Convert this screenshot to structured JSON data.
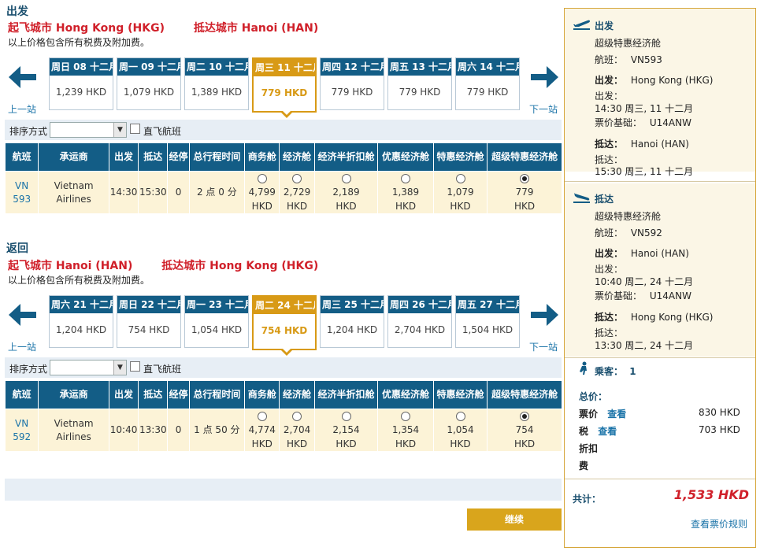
{
  "outbound": {
    "section_title": "出发",
    "from_label": "起飞城市 Hong Kong (HKG)",
    "to_label": "抵达城市 Hanoi (HAN)",
    "tax_note": "以上价格包含所有税费及附加费。",
    "prev_label": "上一站",
    "next_label": "下一站",
    "dates": [
      {
        "label": "周日 08 十二月",
        "price": "1,239 HKD",
        "selected": false
      },
      {
        "label": "周一 09 十二月",
        "price": "1,079 HKD",
        "selected": false
      },
      {
        "label": "周二 10 十二月",
        "price": "1,389 HKD",
        "selected": false
      },
      {
        "label": "周三 11 十二月",
        "price": "779 HKD",
        "selected": true
      },
      {
        "label": "周四 12 十二月",
        "price": "779 HKD",
        "selected": false
      },
      {
        "label": "周五 13 十二月",
        "price": "779 HKD",
        "selected": false
      },
      {
        "label": "周六 14 十二月",
        "price": "779 HKD",
        "selected": false
      }
    ],
    "sort_label": "排序方式",
    "direct_label": "直飞航班",
    "headers": [
      "航班",
      "承运商",
      "出发",
      "抵达",
      "经停",
      "总行程时间",
      "商务舱",
      "经济舱",
      "经济半折扣舱",
      "优惠经济舱",
      "特惠经济舱",
      "超级特惠经济舱"
    ],
    "row": {
      "flight": "VN 593",
      "carrier": "Vietnam Airlines",
      "depart": "14:30",
      "arrive": "15:30",
      "stops": "0",
      "duration": "2 点 0 分",
      "fares": [
        "4,799 HKD",
        "2,729 HKD",
        "2,189 HKD",
        "1,389 HKD",
        "1,079 HKD",
        "779 HKD"
      ],
      "selected_fare": 5
    }
  },
  "return": {
    "section_title": "返回",
    "from_label": "起飞城市 Hanoi (HAN)",
    "to_label": "抵达城市 Hong Kong (HKG)",
    "tax_note": "以上价格包含所有税费及附加费。",
    "prev_label": "上一站",
    "next_label": "下一站",
    "dates": [
      {
        "label": "周六 21 十二月",
        "price": "1,204 HKD",
        "selected": false
      },
      {
        "label": "周日 22 十二月",
        "price": "754 HKD",
        "selected": false
      },
      {
        "label": "周一 23 十二月",
        "price": "1,054 HKD",
        "selected": false
      },
      {
        "label": "周二 24 十二月",
        "price": "754 HKD",
        "selected": true
      },
      {
        "label": "周三 25 十二月",
        "price": "1,204 HKD",
        "selected": false
      },
      {
        "label": "周四 26 十二月",
        "price": "2,704 HKD",
        "selected": false
      },
      {
        "label": "周五 27 十二月",
        "price": "1,504 HKD",
        "selected": false
      }
    ],
    "sort_label": "排序方式",
    "direct_label": "直飞航班",
    "headers": [
      "航班",
      "承运商",
      "出发",
      "抵达",
      "经停",
      "总行程时间",
      "商务舱",
      "经济舱",
      "经济半折扣舱",
      "优惠经济舱",
      "特惠经济舱",
      "超级特惠经济舱"
    ],
    "row": {
      "flight": "VN 592",
      "carrier": "Vietnam Airlines",
      "depart": "10:40",
      "arrive": "13:30",
      "stops": "0",
      "duration": "1 点 50 分",
      "fares": [
        "4,774 HKD",
        "2,704 HKD",
        "2,154 HKD",
        "1,354 HKD",
        "1,054 HKD",
        "754 HKD"
      ],
      "selected_fare": 5
    }
  },
  "continue_label": "继续",
  "summary": {
    "out": {
      "title": "出发",
      "cabin": "超级特惠经济舱",
      "flight_label": "航班：",
      "flight": "VN593",
      "dep_label": "出发：",
      "dep_city": "Hong Kong (HKG)",
      "dep_time_label": "出发：",
      "dep_time": "14:30 周三, 11 十二月",
      "fare_basis_label": "票价基础：",
      "fare_basis": "U14ANW",
      "arr_label": "抵达：",
      "arr_city": "Hanoi (HAN)",
      "arr_time_label": "抵达：",
      "arr_time": "15:30 周三, 11 十二月"
    },
    "ret": {
      "title": "抵达",
      "cabin": "超级特惠经济舱",
      "flight_label": "航班：",
      "flight": "VN592",
      "dep_label": "出发：",
      "dep_city": "Hanoi (HAN)",
      "dep_time_label": "出发：",
      "dep_time": "10:40 周二, 24 十二月",
      "fare_basis_label": "票价基础：",
      "fare_basis": "U14ANW",
      "arr_label": "抵达：",
      "arr_city": "Hong Kong (HKG)",
      "arr_time_label": "抵达：",
      "arr_time": "13:30 周二, 24 十二月"
    },
    "passengers_label": "乘客：",
    "passengers": "1",
    "total_price_label": "总价：",
    "fare_label": "票价",
    "fare_view": "查看",
    "fare_amount": "830 HKD",
    "tax_label": "税",
    "tax_view": "查看",
    "tax_amount": "703 HKD",
    "discount_label": "折扣",
    "fee_label": "费",
    "grand_total_label": "共计：",
    "grand_total": "1,533 HKD",
    "rules_link": "查看票价规则"
  }
}
